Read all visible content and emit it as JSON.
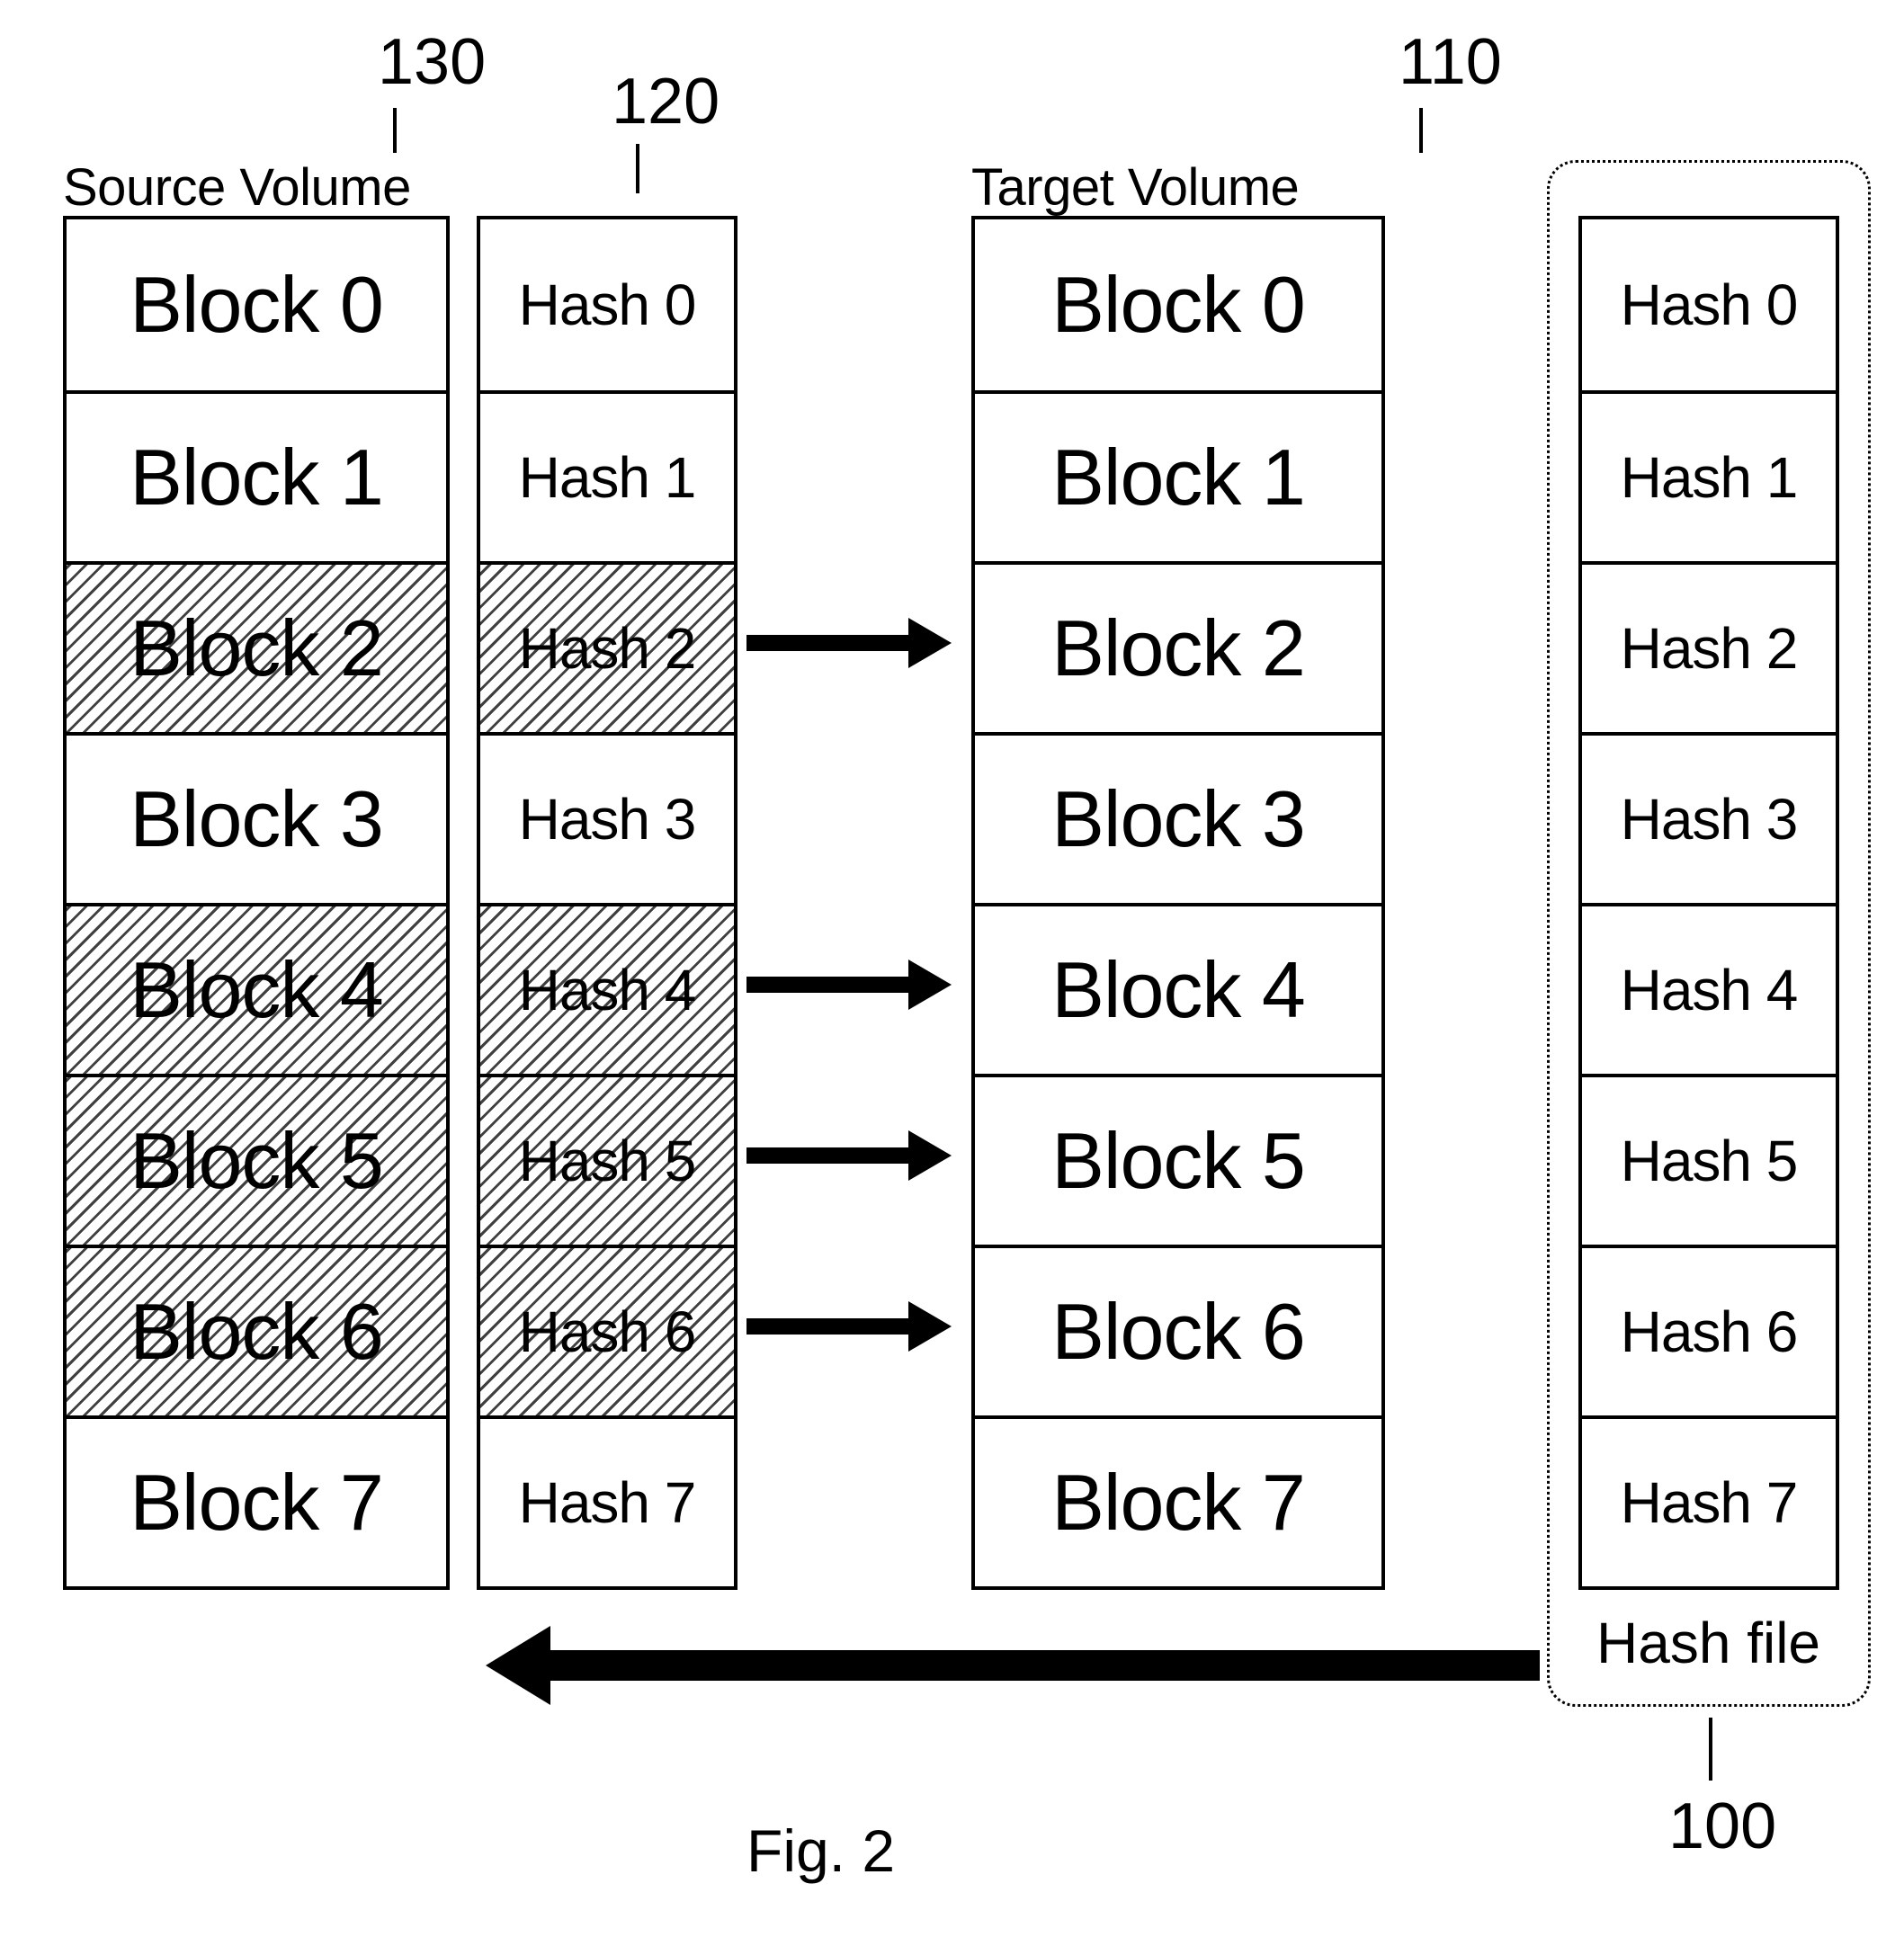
{
  "labels": {
    "source_volume": "Source Volume",
    "target_volume": "Target Volume",
    "hash_file": "Hash file",
    "fig": "Fig. 2"
  },
  "callouts": {
    "n130": "130",
    "n120": "120",
    "n110": "110",
    "n100": "100"
  },
  "columns": {
    "source_blocks": [
      {
        "label": "Block 0",
        "hatched": false
      },
      {
        "label": "Block 1",
        "hatched": false
      },
      {
        "label": "Block 2",
        "hatched": true
      },
      {
        "label": "Block 3",
        "hatched": false
      },
      {
        "label": "Block 4",
        "hatched": true
      },
      {
        "label": "Block 5",
        "hatched": true
      },
      {
        "label": "Block 6",
        "hatched": true
      },
      {
        "label": "Block 7",
        "hatched": false
      }
    ],
    "source_hashes": [
      {
        "label": "Hash 0",
        "hatched": false,
        "arrow": false
      },
      {
        "label": "Hash 1",
        "hatched": false,
        "arrow": false
      },
      {
        "label": "Hash 2",
        "hatched": true,
        "arrow": true
      },
      {
        "label": "Hash 3",
        "hatched": false,
        "arrow": false
      },
      {
        "label": "Hash 4",
        "hatched": true,
        "arrow": true
      },
      {
        "label": "Hash 5",
        "hatched": true,
        "arrow": true
      },
      {
        "label": "Hash 6",
        "hatched": true,
        "arrow": true
      },
      {
        "label": "Hash 7",
        "hatched": false,
        "arrow": false
      }
    ],
    "target_blocks": [
      {
        "label": "Block 0"
      },
      {
        "label": "Block 1"
      },
      {
        "label": "Block 2"
      },
      {
        "label": "Block 3"
      },
      {
        "label": "Block 4"
      },
      {
        "label": "Block 5"
      },
      {
        "label": "Block 6"
      },
      {
        "label": "Block 7"
      }
    ],
    "target_hashes": [
      {
        "label": "Hash 0"
      },
      {
        "label": "Hash 1"
      },
      {
        "label": "Hash 2"
      },
      {
        "label": "Hash 3"
      },
      {
        "label": "Hash 4"
      },
      {
        "label": "Hash 5"
      },
      {
        "label": "Hash 6"
      },
      {
        "label": "Hash 7"
      }
    ]
  },
  "chart_data": {
    "type": "table",
    "description": "Block-level incremental copy diagram: hatched source blocks (2,4,5,6) indicate changed blocks whose hashes differ, so they are copied to target volume.",
    "changed_block_indices": [
      2,
      4,
      5,
      6
    ],
    "reference_numbers": {
      "hash_file": 100,
      "target_volume": 110,
      "source_hashes": 120,
      "source_volume": 130
    }
  }
}
